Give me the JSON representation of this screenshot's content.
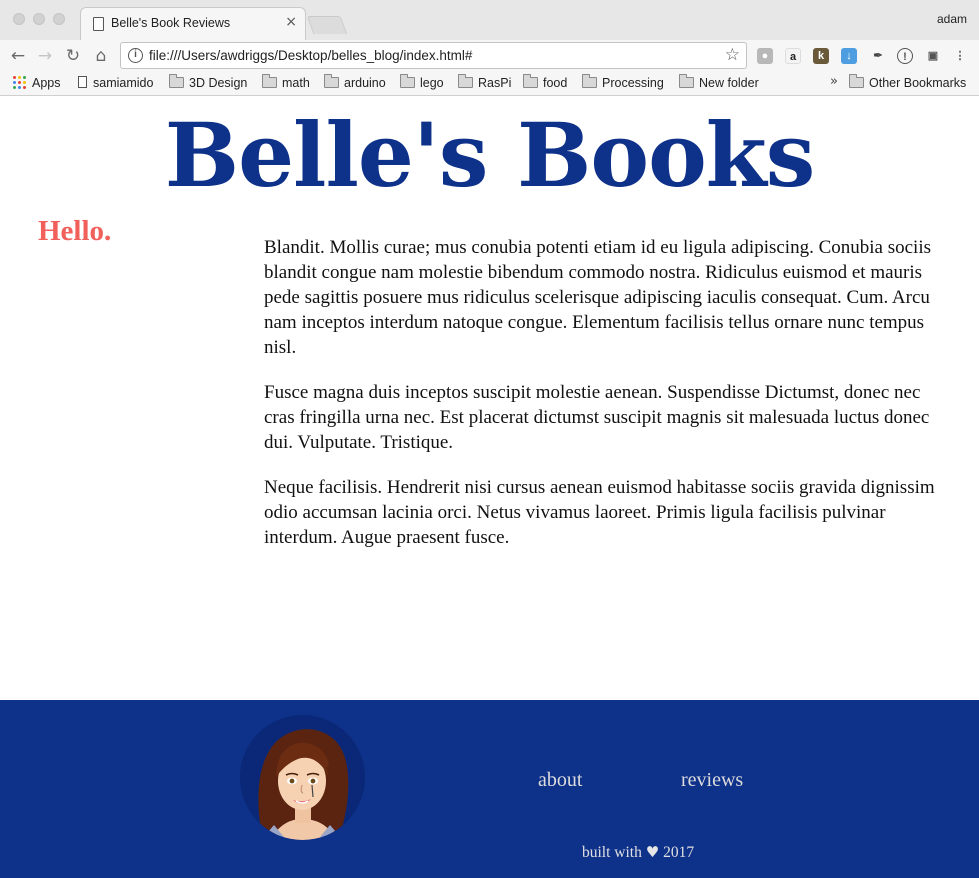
{
  "browser": {
    "tab_title": "Belle's Book Reviews",
    "tab_close": "×",
    "profile_name": "adam",
    "url": "file:///Users/awdriggs/Desktop/belles_blog/index.html#",
    "bookmarks": [
      "Apps",
      "samiamido",
      "3D Design",
      "math",
      "arduino",
      "lego",
      "RasPi",
      "food",
      "Processing",
      "New folder"
    ],
    "overflow_chevron": "»",
    "other_bookmarks": "Other Bookmarks"
  },
  "site": {
    "title": "Belle's Books",
    "greeting": "Hello.",
    "paragraphs": [
      "Blandit. Mollis curae; mus conubia potenti etiam id eu ligula adipiscing. Conubia sociis blandit congue nam molestie bibendum commodo nostra. Ridiculus euismod et mauris pede sagittis posuere mus ridiculus scelerisque adipiscing iaculis consequat. Cum. Arcu nam inceptos interdum natoque congue. Elementum facilisis tellus ornare nunc tempus nisl.",
      "Fusce magna duis inceptos suscipit molestie aenean. Suspendisse Dictumst, donec nec cras fringilla urna nec. Est placerat dictumst suscipit magnis sit malesuada luctus donec dui. Vulputate. Tristique.",
      "Neque facilisis. Hendrerit nisi cursus aenean euismod habitasse sociis gravida dignissim odio accumsan lacinia orci. Netus vivamus laoreet. Primis ligula facilisis pulvinar interdum. Augue praesent fusce."
    ]
  },
  "footer": {
    "nav": {
      "about": "about",
      "reviews": "reviews"
    },
    "built_prefix": "built with",
    "heart": "♥",
    "year": "2017"
  },
  "colors": {
    "brand_blue": "#0e318a",
    "greeting_coral": "#f1605a",
    "footer_text": "#dcdcdc"
  }
}
